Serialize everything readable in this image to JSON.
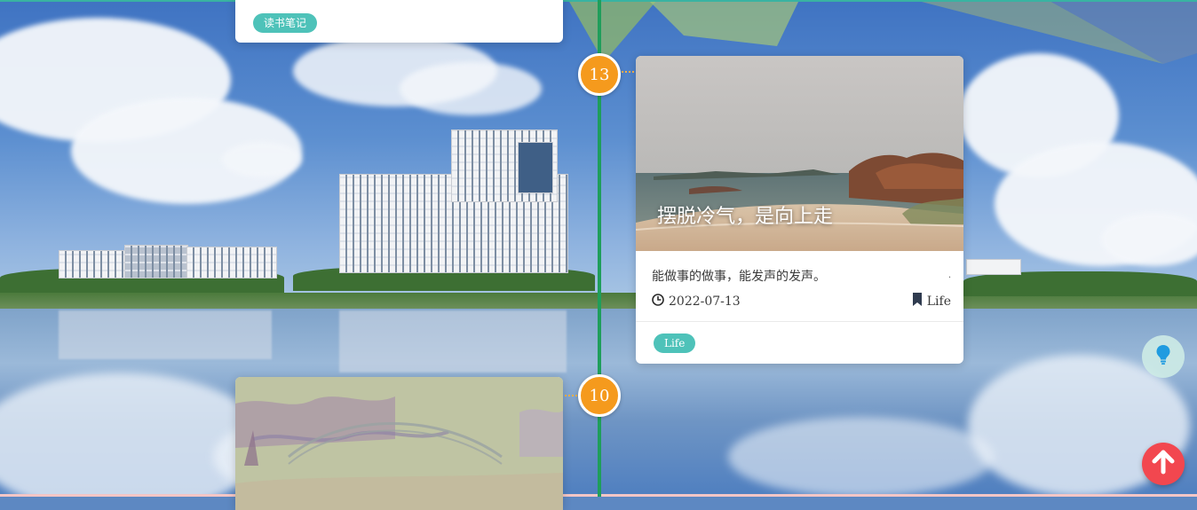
{
  "top_card": {
    "tag": "读书笔记"
  },
  "timeline": {
    "nodes": [
      "13",
      "10"
    ]
  },
  "post": {
    "cover_title": "摆脱冷气，是向上走",
    "excerpt": "能做事的做事，能发声的发声。",
    "date": "2022-07-13",
    "category": "Life",
    "tag": "Life"
  },
  "colors": {
    "axis": "#1f9e5b",
    "node": "#f59a1d",
    "tag": "#4ec2b9",
    "back_to_top": "#f2474f"
  },
  "icons": {
    "date": "clock-icon",
    "category": "bookmark-icon",
    "tip": "lightbulb-icon",
    "back_to_top": "arrow-up-icon"
  }
}
